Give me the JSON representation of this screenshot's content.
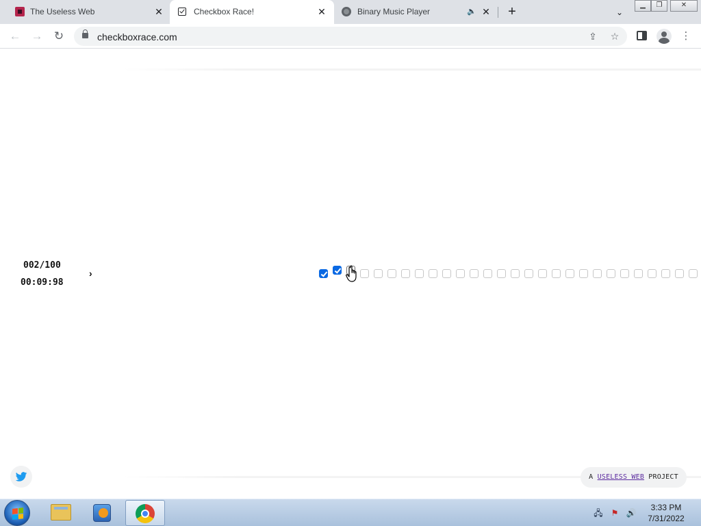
{
  "browser": {
    "tabs": [
      {
        "title": "The Useless Web",
        "icon": "useless-web-favicon",
        "active": false
      },
      {
        "title": "Checkbox Race!",
        "icon": "checkbox-favicon",
        "active": true
      },
      {
        "title": "Binary Music Player",
        "icon": "globe-favicon",
        "active": false,
        "audio": true
      }
    ],
    "new_tab_label": "+",
    "url": "checkboxrace.com"
  },
  "page": {
    "counter": "002/100",
    "timer": "00:09:98",
    "arrow": "›",
    "checkboxes": {
      "total": 28,
      "checked": 2,
      "active_index": 2
    },
    "footer": {
      "badge_prefix": "A ",
      "badge_link": "USELESS WEB",
      "badge_suffix": " PROJECT"
    }
  },
  "taskbar": {
    "apps": [
      "windows-explorer",
      "windows-media-player",
      "google-chrome"
    ],
    "active_app": "google-chrome",
    "clock_time": "3:33 PM",
    "clock_date": "7/31/2022"
  },
  "colors": {
    "checkbox_accent": "#0a69e3",
    "useless_web_brand": "#b4244c",
    "twitter_blue": "#1d9bf0"
  }
}
